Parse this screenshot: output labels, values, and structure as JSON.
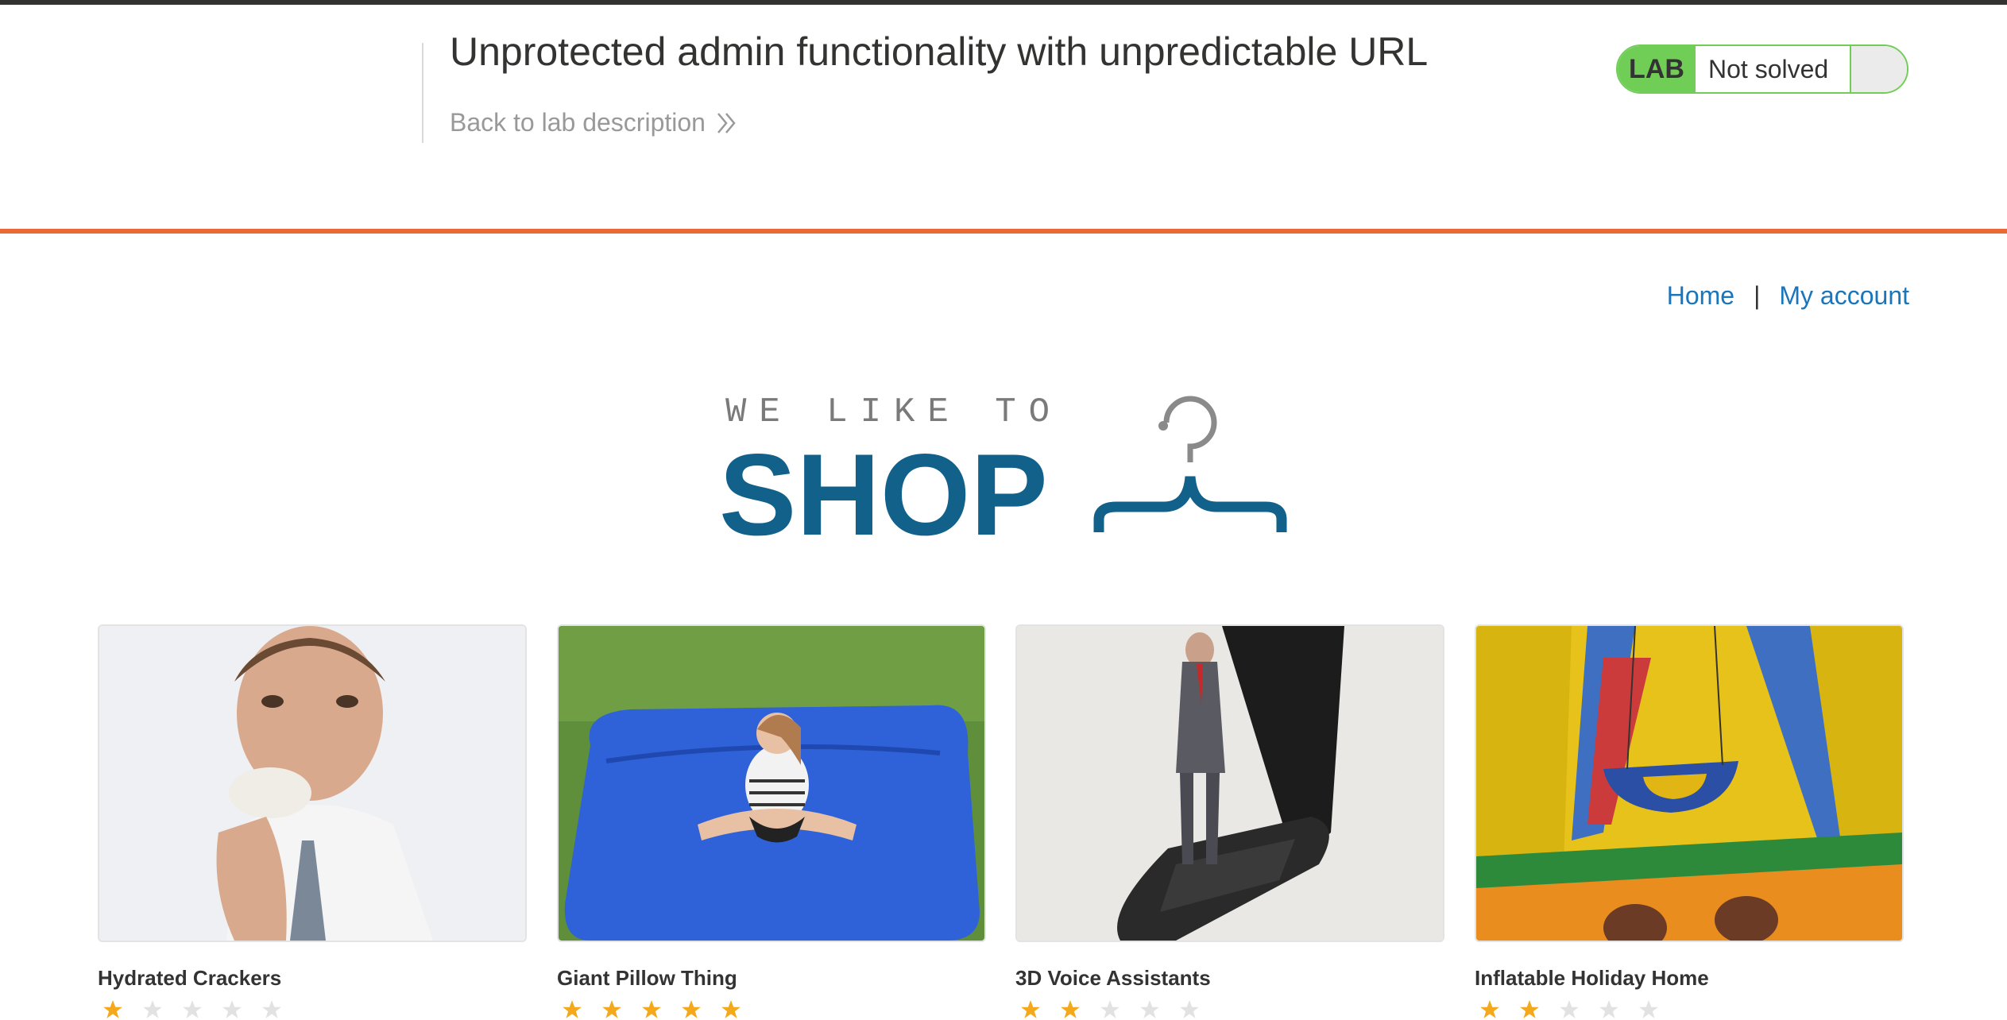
{
  "lab_header": {
    "title": "Unprotected admin functionality with unpredictable URL",
    "back_link": "Back to lab description",
    "badge": "LAB",
    "status": "Not solved"
  },
  "nav": {
    "home": "Home",
    "separator": "|",
    "account": "My account"
  },
  "logo": {
    "line1": "WE LIKE TO",
    "line2": "SHOP"
  },
  "colors": {
    "orange_accent": "#e96937",
    "lab_green": "#70ce56",
    "link_blue": "#1b75bb",
    "logo_blue": "#11618a"
  },
  "products": [
    {
      "name": "Hydrated Crackers",
      "rating": 1
    },
    {
      "name": "Giant Pillow Thing",
      "rating": 5
    },
    {
      "name": "3D Voice Assistants",
      "rating": 2
    },
    {
      "name": "Inflatable Holiday Home",
      "rating": 2
    }
  ]
}
